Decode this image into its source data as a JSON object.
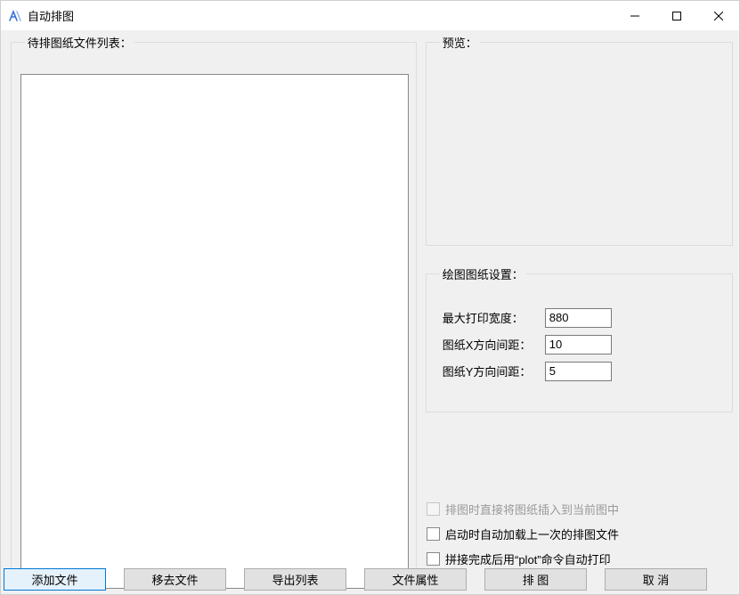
{
  "titlebar": {
    "title": "自动排图"
  },
  "left": {
    "legend": "待排图纸文件列表："
  },
  "preview": {
    "legend": "预览："
  },
  "settings": {
    "legend": "绘图图纸设置：",
    "max_width_label": "最大打印宽度：",
    "max_width_value": "880",
    "x_gap_label": "图纸X方向间距：",
    "x_gap_value": "10",
    "y_gap_label": "图纸Y方向间距：",
    "y_gap_value": "5"
  },
  "checks": {
    "insert_current": "排图时直接将图纸插入到当前图中",
    "autoload_last": "启动时自动加载上一次的排图文件",
    "autoplot": "拼接完成后用“plot”命令自动打印"
  },
  "buttons": {
    "add": "添加文件",
    "remove": "移去文件",
    "export": "导出列表",
    "props": "文件属性",
    "layout": "排  图",
    "cancel": "取  消"
  }
}
